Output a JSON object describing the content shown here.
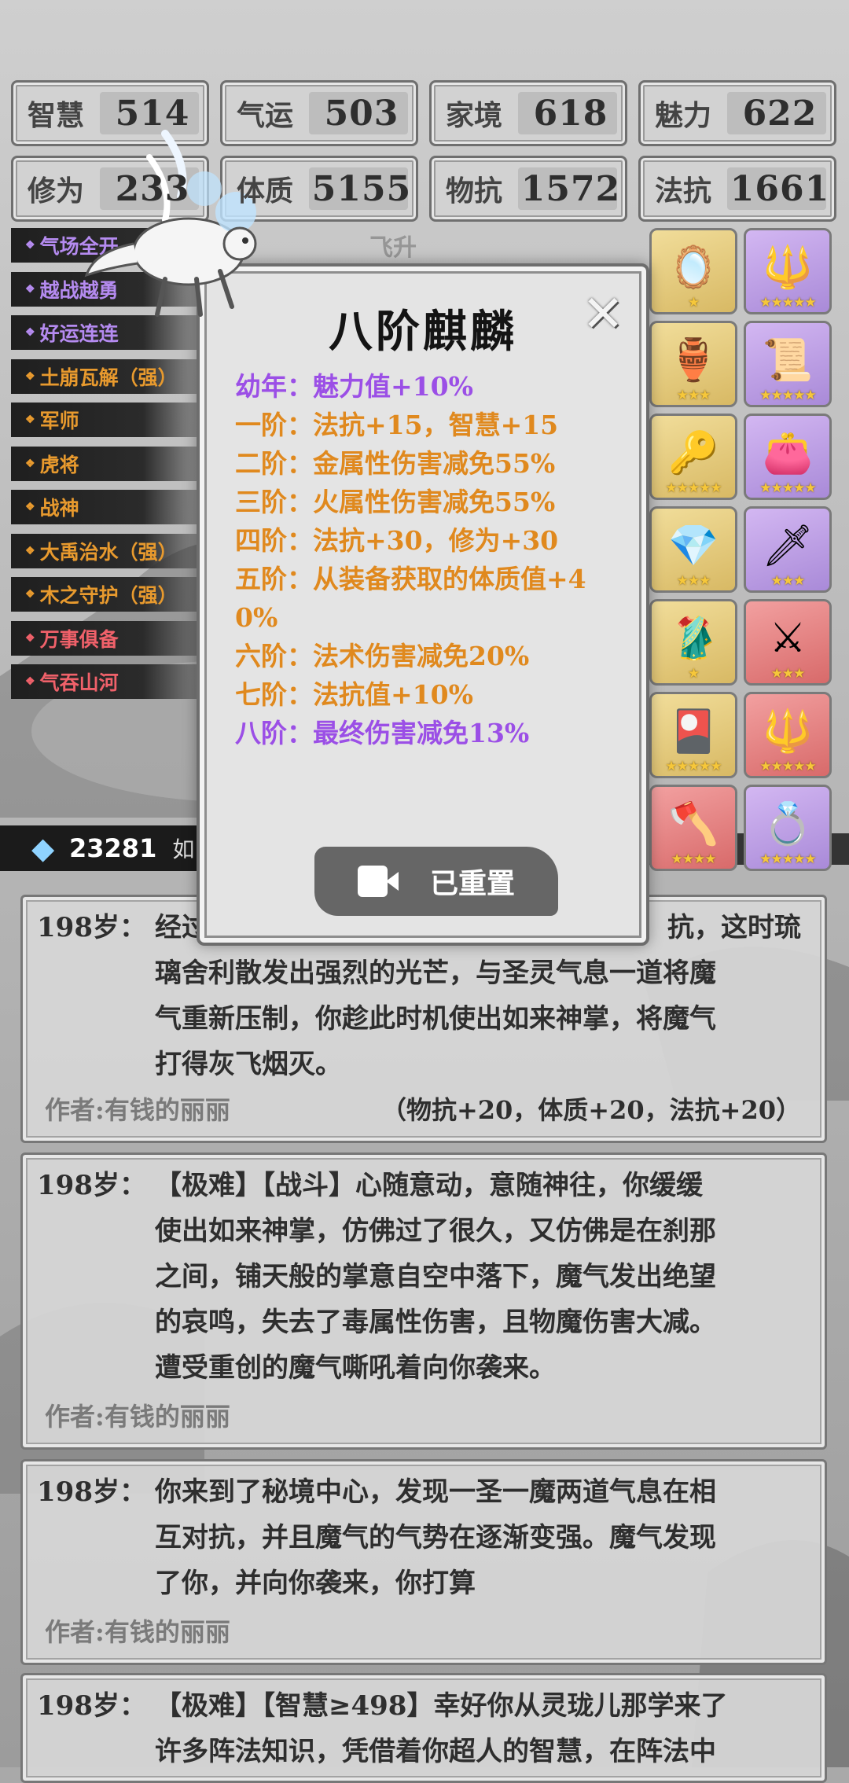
{
  "stats": [
    {
      "label": "智慧",
      "value": "514"
    },
    {
      "label": "气运",
      "value": "503"
    },
    {
      "label": "家境",
      "value": "618"
    },
    {
      "label": "魅力",
      "value": "622"
    },
    {
      "label": "修为",
      "value": "233"
    },
    {
      "label": "体质",
      "value": "5155"
    },
    {
      "label": "物抗",
      "value": "1572"
    },
    {
      "label": "法抗",
      "value": "1661"
    }
  ],
  "talents": [
    {
      "label": "气场全开",
      "color": "purple"
    },
    {
      "label": "越战越勇",
      "color": "purple"
    },
    {
      "label": "好运连连",
      "color": "purple"
    },
    {
      "label": "土崩瓦解（强）",
      "color": "orange"
    },
    {
      "label": "军师",
      "color": "orange"
    },
    {
      "label": "虎将",
      "color": "orange"
    },
    {
      "label": "战神",
      "color": "orange"
    },
    {
      "label": "大禹治水（强）",
      "color": "orange"
    },
    {
      "label": "木之守护（强）",
      "color": "orange"
    },
    {
      "label": "万事俱备",
      "color": "red"
    },
    {
      "label": "气吞山河",
      "color": "red"
    }
  ],
  "equipment": [
    {
      "name": "mirror",
      "rarity": "gold",
      "stars": "★",
      "glyph": "🪞"
    },
    {
      "name": "talisman",
      "rarity": "purple",
      "stars": "★★★★★",
      "glyph": "🔱"
    },
    {
      "name": "cauldron",
      "rarity": "gold",
      "stars": "★★★",
      "glyph": "🏺"
    },
    {
      "name": "scroll",
      "rarity": "purple",
      "stars": "★★★★★",
      "glyph": "📜"
    },
    {
      "name": "scepter",
      "rarity": "gold",
      "stars": "★★★★★",
      "glyph": "🔑"
    },
    {
      "name": "pouch",
      "rarity": "purple",
      "stars": "★★★★★",
      "glyph": "👛"
    },
    {
      "name": "crystal",
      "rarity": "gold",
      "stars": "★★★",
      "glyph": "💎"
    },
    {
      "name": "dagger",
      "rarity": "purple",
      "stars": "★★★",
      "glyph": "🗡"
    },
    {
      "name": "robe",
      "rarity": "gold",
      "stars": "★",
      "glyph": "🥻"
    },
    {
      "name": "sword",
      "rarity": "red",
      "stars": "★★★",
      "glyph": "⚔"
    },
    {
      "name": "token",
      "rarity": "gold",
      "stars": "★★★★★",
      "glyph": "🎴"
    },
    {
      "name": "spear",
      "rarity": "red",
      "stars": "★★★★★",
      "glyph": "🔱"
    },
    {
      "name": "axe",
      "rarity": "red",
      "stars": "★★★★",
      "glyph": "🪓"
    },
    {
      "name": "ring",
      "rarity": "purple",
      "stars": "★★★★★",
      "glyph": "💍"
    }
  ],
  "gems": {
    "count": "23281",
    "extra": "如"
  },
  "modal": {
    "title": "八阶麒麟",
    "close": "✕",
    "stages": [
      {
        "text": "幼年：魅力值+10%",
        "color": "purple"
      },
      {
        "text": "一阶：法抗+15，智慧+15",
        "color": "orange"
      },
      {
        "text": "二阶：金属性伤害减免55%",
        "color": "orange"
      },
      {
        "text": "三阶：火属性伤害减免55%",
        "color": "orange"
      },
      {
        "text": "四阶：法抗+30，修为+30",
        "color": "orange"
      },
      {
        "text": "五阶：从装备获取的体质值+4",
        "color": "orange"
      },
      {
        "text": "0%",
        "color": "orange"
      },
      {
        "text": "六阶：法术伤害减免20%",
        "color": "orange"
      },
      {
        "text": "七阶：法抗值+10%",
        "color": "orange"
      },
      {
        "text": "八阶：最终伤害减免13%",
        "color": "purple"
      }
    ],
    "button": "已重置",
    "behind_label": "飞升"
  },
  "cards": [
    {
      "age": "198岁：",
      "lines": [
        "经过",
        "璃舍利散发出强烈的光芒，与圣灵气息一道将魔",
        "气重新压制，你趁此时机使出如来神掌，将魔气",
        "打得灰飞烟灭。"
      ],
      "first_line_tail": "抗，这时琉",
      "author": "作者:有钱的丽丽",
      "bonus": "（物抗+20，体质+20，法抗+20）"
    },
    {
      "age": "198岁：",
      "lines": [
        "【极难】【战斗】心随意动，意随神往，你缓缓",
        "使出如来神掌，仿佛过了很久，又仿佛是在刹那",
        "之间，铺天般的掌意自空中落下，魔气发出绝望",
        "的哀鸣，失去了毒属性伤害，且物魔伤害大减。",
        "遭受重创的魔气嘶吼着向你袭来。"
      ],
      "author": "作者:有钱的丽丽",
      "bonus": ""
    },
    {
      "age": "198岁：",
      "lines": [
        "你来到了秘境中心，发现一圣一魔两道气息在相",
        "互对抗，并且魔气的气势在逐渐变强。魔气发现",
        "了你，并向你袭来，你打算"
      ],
      "author": "作者:有钱的丽丽",
      "bonus": ""
    },
    {
      "age": "198岁：",
      "lines": [
        "【极难】【智慧≥498】幸好你从灵珑儿那学来了",
        "许多阵法知识，凭借着你超人的智慧，在阵法中"
      ],
      "author": "",
      "bonus": ""
    }
  ],
  "colors": {
    "purple": "#9b4fe6",
    "orange": "#e0891e",
    "red": "#f0616a"
  }
}
